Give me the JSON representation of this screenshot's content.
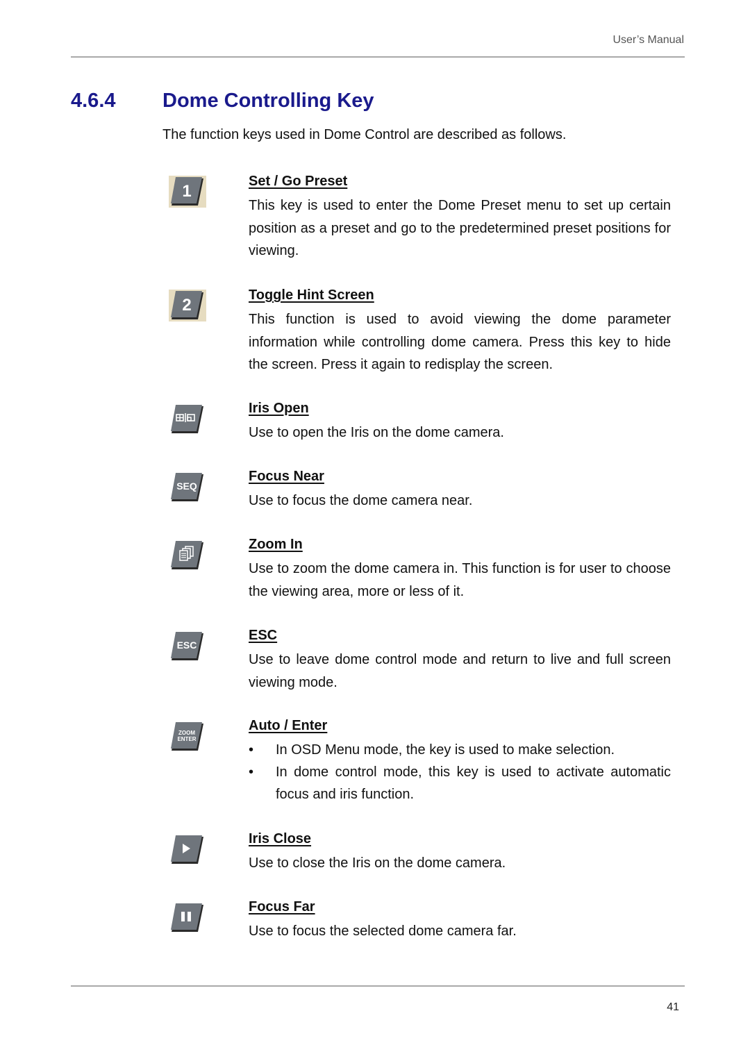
{
  "header": {
    "running_title": "User’s Manual"
  },
  "section": {
    "number": "4.6.4",
    "title": "Dome Controlling Key",
    "intro": "The function keys used in Dome Control are described as follows."
  },
  "keys": [
    {
      "icon": "key-1-icon",
      "icon_label": "1",
      "title": "Set / Go Preset",
      "description": "This key is used to enter the Dome Preset menu to set up certain position as a preset and go to the predetermined preset positions for viewing."
    },
    {
      "icon": "key-2-icon",
      "icon_label": "2",
      "title": "Toggle Hint Screen",
      "description": "This function is used to avoid viewing the dome parameter information while controlling dome camera. Press this key to hide the screen. Press it again to redisplay the screen."
    },
    {
      "icon": "split-screen-key-icon",
      "icon_label": "⊞|◱",
      "title": "Iris Open",
      "description": "Use to open the Iris on the dome camera."
    },
    {
      "icon": "seq-key-icon",
      "icon_label": "SEQ",
      "title": "Focus Near",
      "description": "Use to focus the dome camera near."
    },
    {
      "icon": "copy-pages-key-icon",
      "icon_label": "",
      "title": "Zoom In",
      "description": "Use to zoom the dome camera in. This function is for user to choose the viewing area, more or less of it."
    },
    {
      "icon": "esc-key-icon",
      "icon_label": "ESC",
      "title": "ESC",
      "description": "Use to leave dome control mode and return to live and full screen viewing mode."
    },
    {
      "icon": "zoom-enter-key-icon",
      "icon_label_line1": "ZOOM",
      "icon_label_line2": "ENTER",
      "title": "Auto / Enter",
      "bullets": [
        "In OSD Menu mode, the key is used to make selection.",
        "In dome control mode, this key is used to activate automatic focus and iris function."
      ]
    },
    {
      "icon": "play-key-icon",
      "icon_label": "",
      "title": "Iris Close",
      "description": "Use to close the Iris on the dome camera."
    },
    {
      "icon": "pause-key-icon",
      "icon_label": "",
      "title": "Focus Far",
      "description": "Use to focus the selected dome camera far."
    }
  ],
  "footer": {
    "page_number": "41"
  },
  "colors": {
    "heading": "#1a1a8c",
    "key_face": "#6f757c",
    "key_shadow": "#2a2a2a",
    "key_bg_beige": "#e6dcc0"
  }
}
